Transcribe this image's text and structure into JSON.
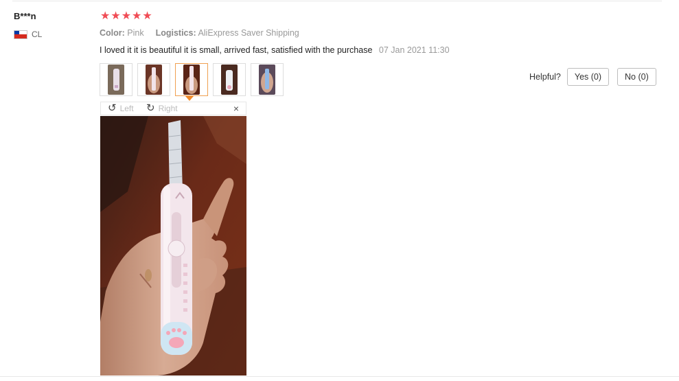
{
  "review": {
    "user_name": "B***n",
    "country_code": "CL",
    "rating": 5,
    "stars": [
      "★",
      "★",
      "★",
      "★",
      "★"
    ],
    "attributes": {
      "color_key": "Color:",
      "color_value": "Pink",
      "logistics_key": "Logistics:",
      "logistics_value": "AliExpress Saver Shipping"
    },
    "text": "I loved it it is beautiful it is small, arrived fast, satisfied with the purchase",
    "date": "07 Jan 2021 11:30"
  },
  "gallery": {
    "thumbnail_count": 5,
    "selected_index": 2
  },
  "viewer": {
    "rotate_left_label": "Left",
    "rotate_right_label": "Right",
    "rotate_left_icon": "↺",
    "rotate_right_icon": "↻",
    "close_icon": "×"
  },
  "helpful": {
    "label": "Helpful?",
    "yes_label": "Yes (0)",
    "no_label": "No (0)"
  },
  "colors": {
    "star": "#f04c55",
    "selected_thumb_border": "#f0a050",
    "arrow": "#f28a2a"
  }
}
